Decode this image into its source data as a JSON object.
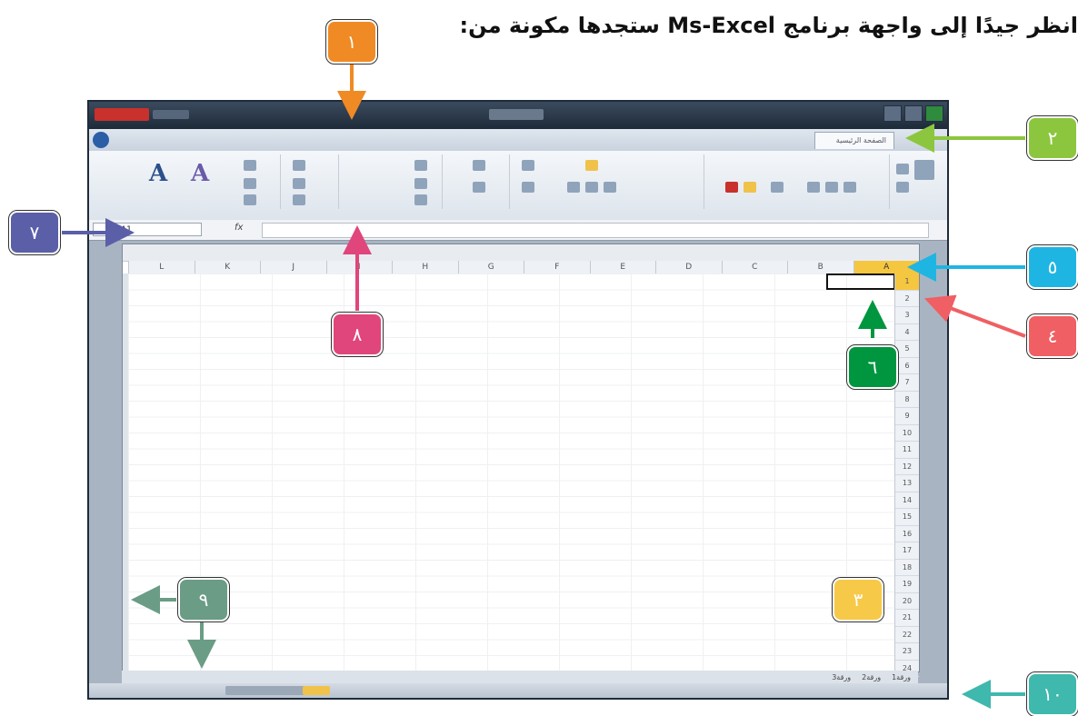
{
  "headline": "انظر جيدًا إلى واجهة برنامج Ms-Excel ستجدها مكونة من:",
  "excel": {
    "name_box": "A1",
    "fx_label": "fx",
    "active_tab": "الصفحة الرئيسية",
    "column_headers": [
      "A",
      "B",
      "C",
      "D",
      "E",
      "F",
      "G",
      "H",
      "I",
      "J",
      "K",
      "L"
    ],
    "row_numbers": [
      "1",
      "2",
      "3",
      "4",
      "5",
      "6",
      "7",
      "8",
      "9",
      "10",
      "11",
      "12",
      "13",
      "14",
      "15",
      "16",
      "17",
      "18",
      "19",
      "20",
      "21",
      "22",
      "23",
      "24"
    ],
    "sheet_tabs": [
      "ورقة1",
      "ورقة2",
      "ورقة3"
    ]
  },
  "callouts": [
    {
      "num": "١",
      "color": "#f08a24"
    },
    {
      "num": "٢",
      "color": "#8cc63f"
    },
    {
      "num": "٣",
      "color": "#f7c948"
    },
    {
      "num": "٤",
      "color": "#ef5f63"
    },
    {
      "num": "٥",
      "color": "#1fb5e3"
    },
    {
      "num": "٦",
      "color": "#00963f"
    },
    {
      "num": "٧",
      "color": "#5a5fa8"
    },
    {
      "num": "٨",
      "color": "#e0457b"
    },
    {
      "num": "٩",
      "color": "#6a9c86"
    },
    {
      "num": "١٠",
      "color": "#3fb8ad"
    }
  ]
}
